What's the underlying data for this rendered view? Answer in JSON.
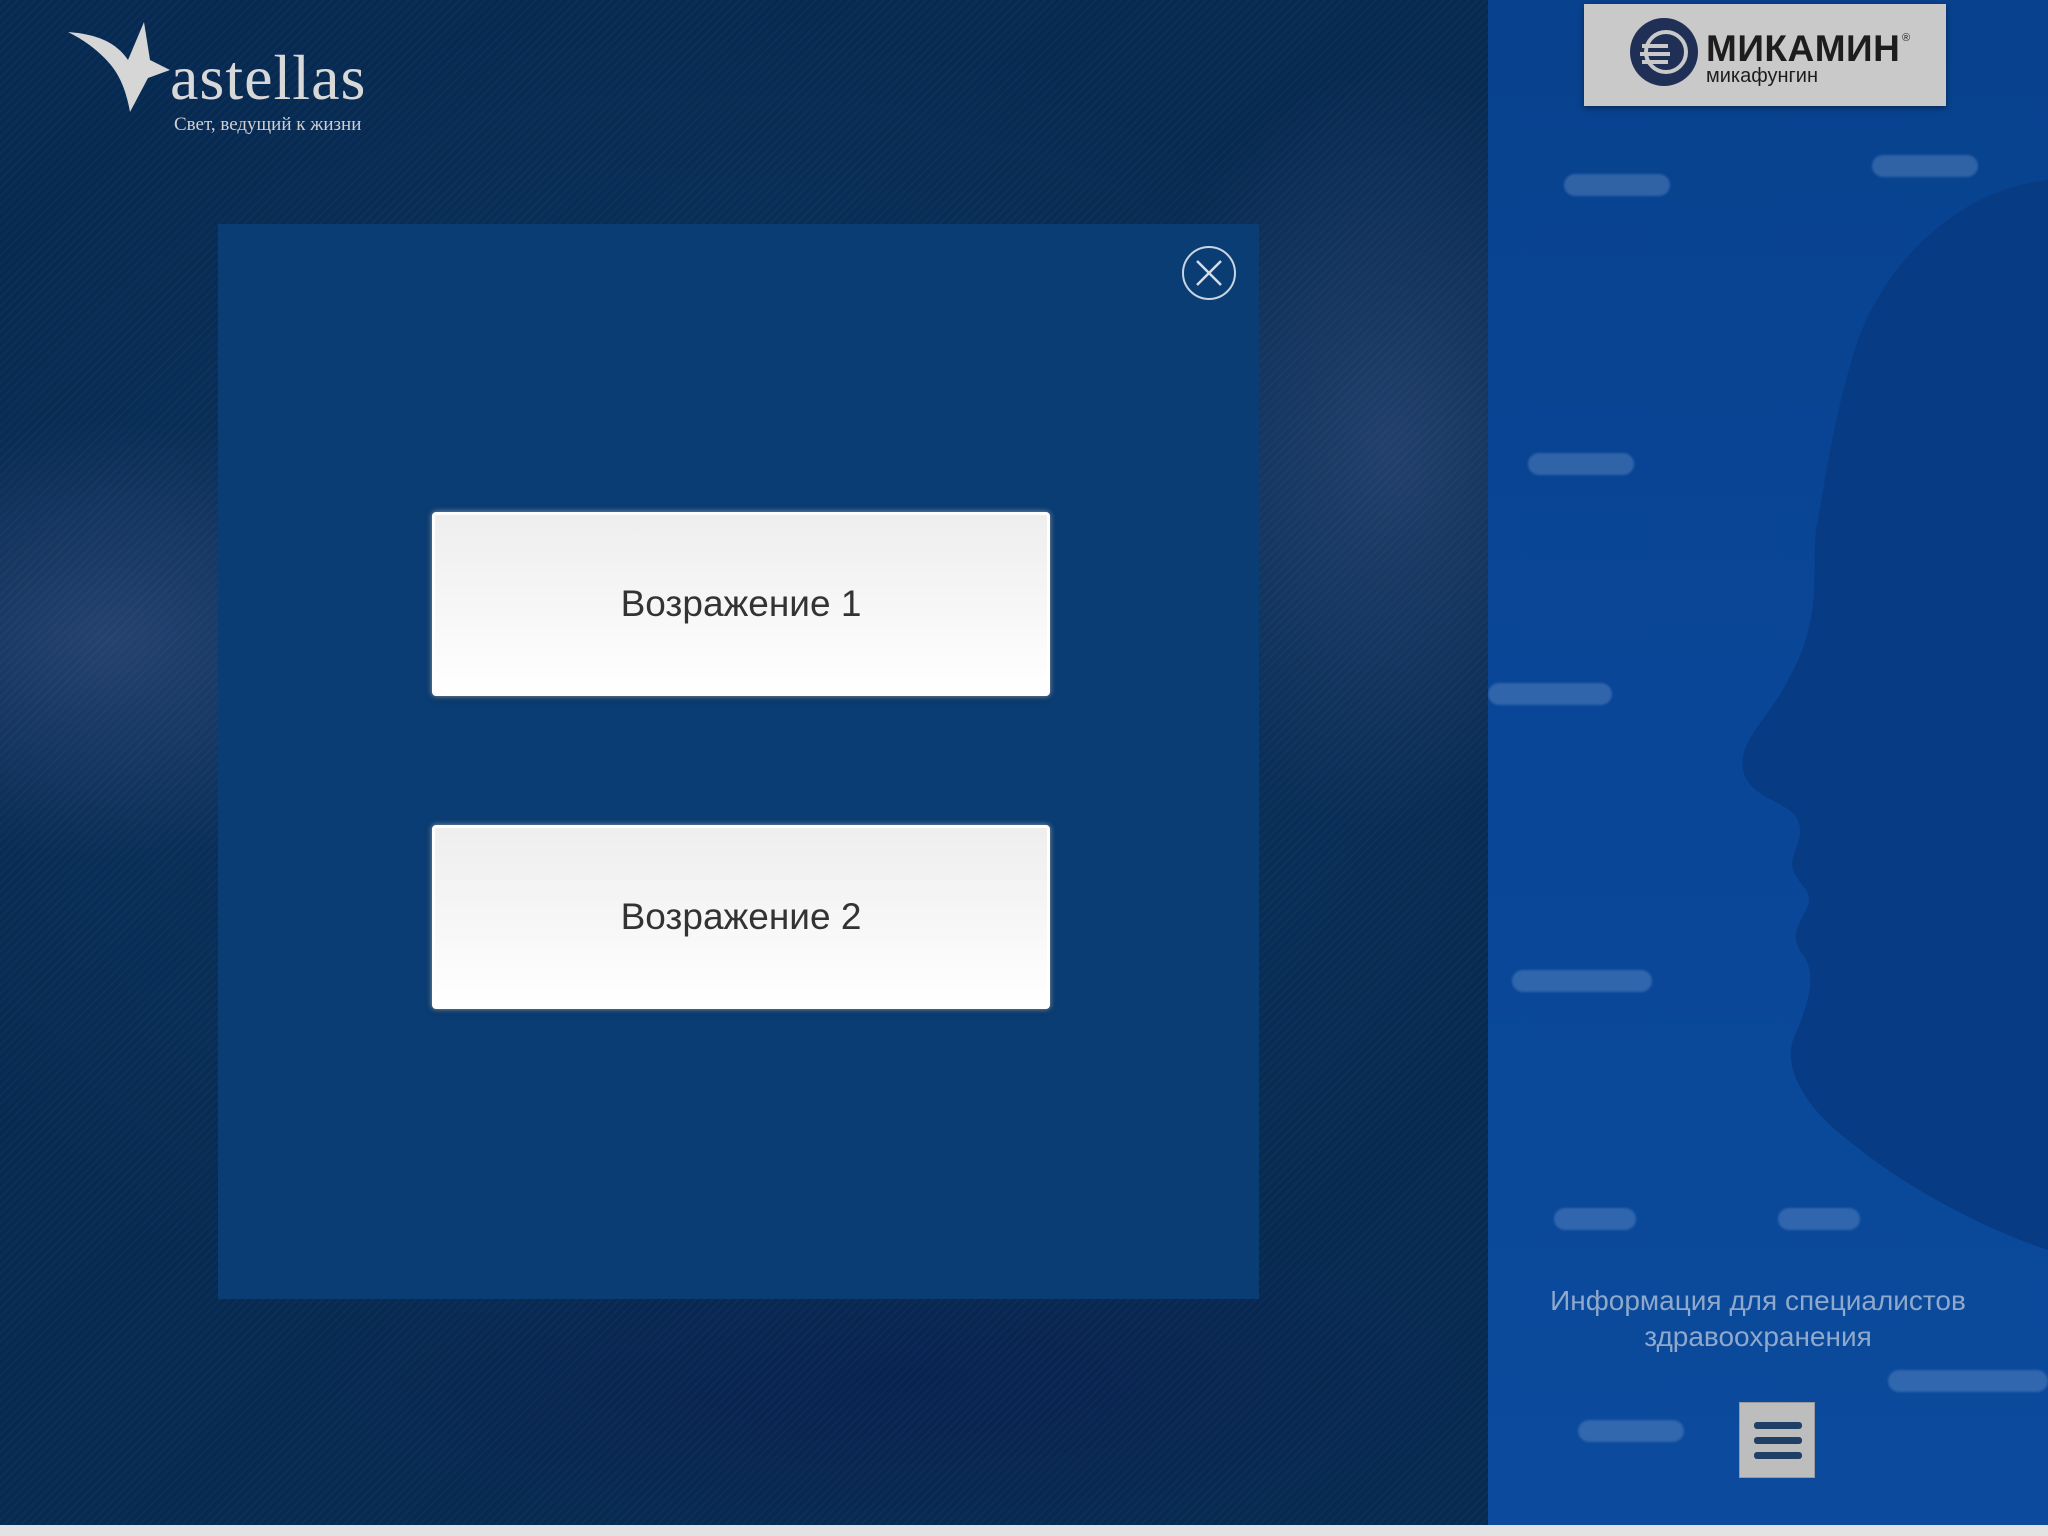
{
  "brand": {
    "name": "astellas",
    "tagline": "Свет, ведущий к жизни",
    "icon": "star-logo-icon"
  },
  "product": {
    "name": "МИКАМИН",
    "registered_mark": "®",
    "subtitle": "микафунгин",
    "icon": "mikamin-emblem-icon"
  },
  "modal": {
    "close_icon": "close-icon",
    "options": [
      {
        "label": "Возражение 1"
      },
      {
        "label": "Возражение 2"
      }
    ]
  },
  "sidebar": {
    "info_line1": "Информация для специалистов",
    "info_line2": "здравоохранения",
    "menu_icon": "hamburger-menu-icon"
  },
  "colors": {
    "left_background": "#072a52",
    "right_background": "#0a4698",
    "modal_background": "#0a3d74",
    "button_background": "#f4f4f4",
    "button_text": "#333333",
    "info_text": "#8ea9cc"
  }
}
